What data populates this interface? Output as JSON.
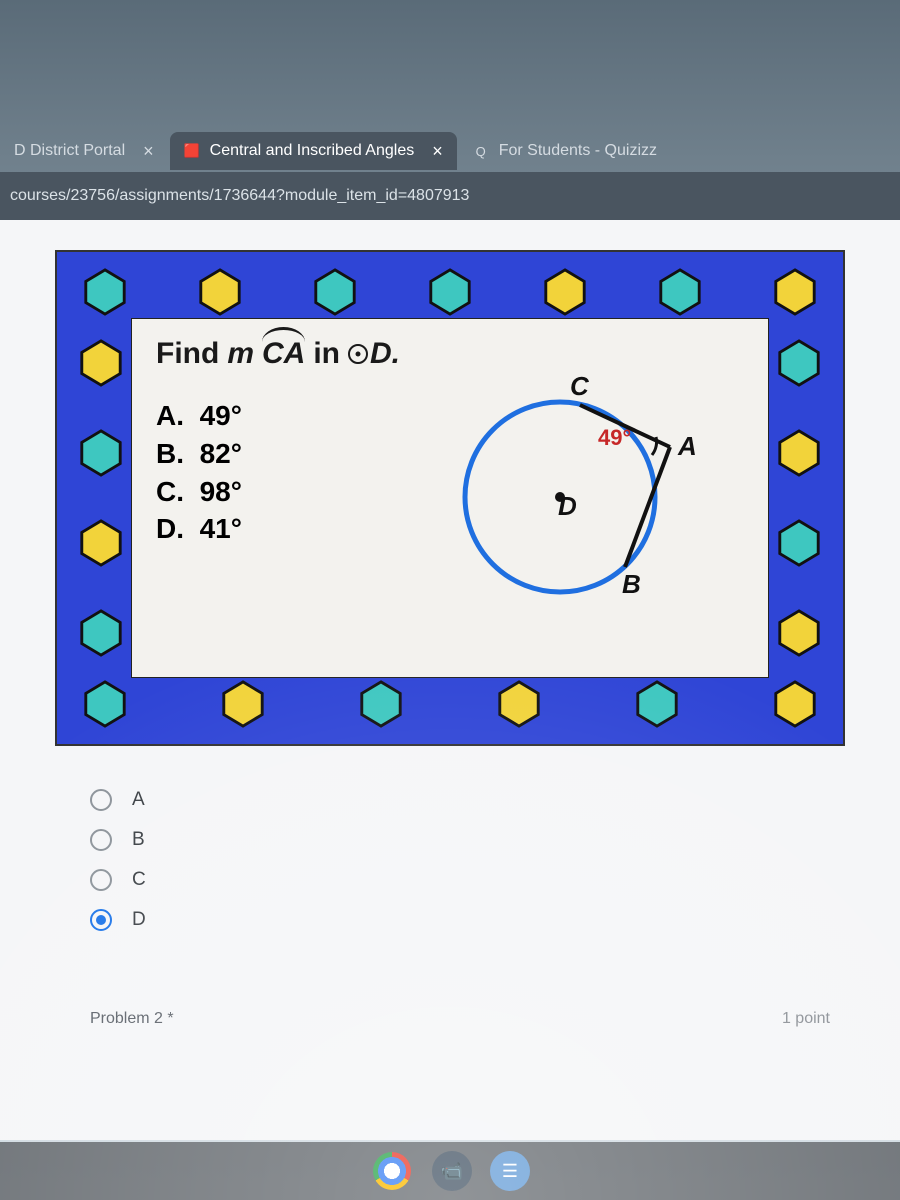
{
  "tabs": {
    "left": {
      "label": "D District Portal",
      "active": false
    },
    "center": {
      "label": "Central and Inscribed Angles",
      "active": true
    },
    "right": {
      "label": "For Students - Quizizz",
      "active": false
    }
  },
  "url": "courses/23756/assignments/1736644?module_item_id=4807913",
  "problem": {
    "prompt_pre": "Find",
    "prompt_m": "m",
    "prompt_arc": "CA",
    "prompt_in": "in",
    "prompt_circle": "D.",
    "choices": [
      {
        "letter": "A.",
        "value": "49°"
      },
      {
        "letter": "B.",
        "value": "82°"
      },
      {
        "letter": "C.",
        "value": "98°"
      },
      {
        "letter": "D.",
        "value": "41°"
      }
    ],
    "diagram": {
      "angle_label": "49°",
      "points": {
        "C": "C",
        "A": "A",
        "D": "D",
        "B": "B"
      }
    }
  },
  "answers": {
    "options": [
      "A",
      "B",
      "C",
      "D"
    ],
    "selected": "D"
  },
  "footer": {
    "next_label": "Problem 2 *",
    "points": "1 point"
  },
  "colors": {
    "frame_blue": "#2f45d6",
    "hex_yellow": "#f2d33a",
    "hex_teal": "#3ec7c0",
    "circle_blue": "#1f6fe0",
    "angle_red": "#c62828"
  }
}
